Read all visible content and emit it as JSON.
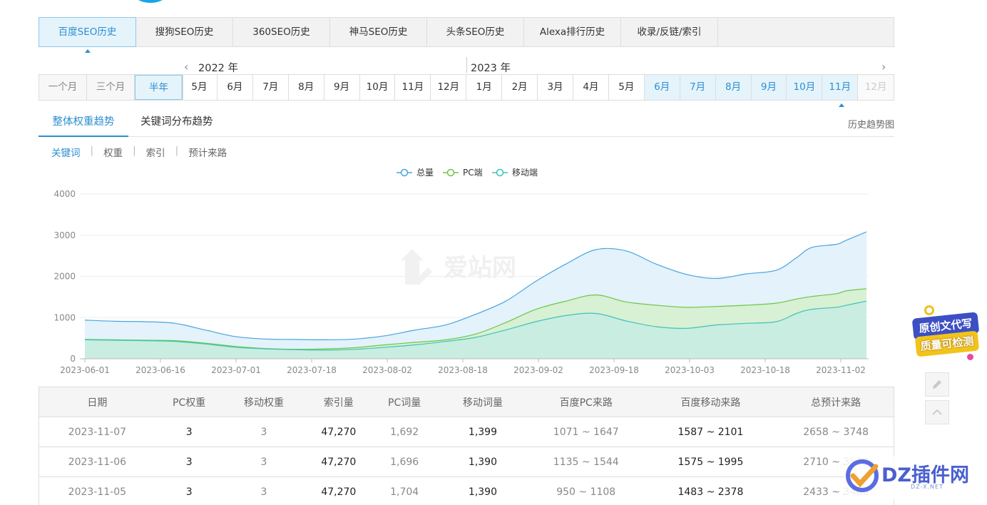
{
  "top_tabs": [
    "百度SEO历史",
    "搜狗SEO历史",
    "360SEO历史",
    "神马SEO历史",
    "头条SEO历史",
    "Alexa排行历史",
    "收录/反链/索引"
  ],
  "year_left": "2022 年",
  "year_right": "2023 年",
  "range_options": [
    "一个月",
    "三个月",
    "半年"
  ],
  "months": [
    "5月",
    "6月",
    "7月",
    "8月",
    "9月",
    "10月",
    "11月",
    "12月",
    "1月",
    "2月",
    "3月",
    "4月",
    "5月",
    "6月",
    "7月",
    "8月",
    "9月",
    "10月",
    "11月",
    "12月"
  ],
  "subtabs": [
    "整体权重趋势",
    "关键词分布趋势"
  ],
  "history_link": "历史趋势图",
  "metrics": [
    "关键词",
    "权重",
    "索引",
    "预计来路"
  ],
  "watermark": "爱站网",
  "chart_data": {
    "type": "area",
    "x_ticks": [
      "2023-06-01",
      "2023-06-16",
      "2023-07-01",
      "2023-07-18",
      "2023-08-02",
      "2023-08-18",
      "2023-09-02",
      "2023-09-18",
      "2023-10-03",
      "2023-10-18",
      "2023-11-02"
    ],
    "y_ticks": [
      "4000",
      "3000",
      "2000",
      "1000",
      "0"
    ],
    "ylim": [
      0,
      4000
    ],
    "legend_position": "top-center",
    "grid": true,
    "x_days": [
      0,
      6,
      12,
      18,
      24,
      30,
      36,
      42,
      48,
      54,
      60,
      66,
      72,
      78,
      84,
      90,
      96,
      102,
      108,
      114,
      120,
      126,
      132,
      138,
      142,
      145,
      150,
      152,
      156
    ],
    "series": [
      {
        "name": "总量",
        "color": "#4aa3df",
        "fill": "#e3f2fb",
        "values": [
          940,
          910,
          900,
          860,
          700,
          540,
          480,
          470,
          460,
          480,
          560,
          700,
          820,
          1080,
          1400,
          1880,
          2300,
          2650,
          2620,
          2300,
          2050,
          1950,
          2060,
          2150,
          2450,
          2700,
          2780,
          2880,
          3080
        ]
      },
      {
        "name": "PC端",
        "color": "#6cc644",
        "fill": "#d6f0cd",
        "values": [
          470,
          460,
          450,
          440,
          380,
          300,
          250,
          230,
          240,
          270,
          340,
          400,
          460,
          600,
          880,
          1200,
          1400,
          1550,
          1380,
          1300,
          1250,
          1270,
          1300,
          1350,
          1450,
          1510,
          1580,
          1650,
          1700
        ]
      },
      {
        "name": "移动端",
        "color": "#3cc4b4",
        "fill": "#c7ece3",
        "values": [
          460,
          450,
          440,
          420,
          360,
          280,
          240,
          220,
          210,
          230,
          280,
          340,
          420,
          520,
          700,
          900,
          1050,
          1100,
          920,
          780,
          740,
          820,
          860,
          900,
          1100,
          1200,
          1250,
          1300,
          1400
        ]
      }
    ]
  },
  "table": {
    "headers": [
      "日期",
      "PC权重",
      "移动权重",
      "索引量",
      "PC词量",
      "移动词量",
      "百度PC来路",
      "百度移动来路",
      "总预计来路"
    ],
    "rows": [
      [
        "2023-11-07",
        "3",
        "3",
        "47,270",
        "1,692",
        "1,399",
        "1071 ~ 1647",
        "1587 ~ 2101",
        "2658 ~ 3748"
      ],
      [
        "2023-11-06",
        "3",
        "3",
        "47,270",
        "1,696",
        "1,390",
        "1135 ~ 1544",
        "1575 ~ 1995",
        "2710 ~ 3539"
      ],
      [
        "2023-11-05",
        "3",
        "3",
        "47,270",
        "1,704",
        "1,390",
        "950 ~ 1108",
        "1483 ~ 2378",
        "2433 ~ 3486"
      ]
    ]
  },
  "badge": {
    "line1": "原创文代写",
    "line2": "质量可检测"
  },
  "dz_logo": {
    "text": "DZ插件网",
    "url": "DZ-X.NET"
  }
}
